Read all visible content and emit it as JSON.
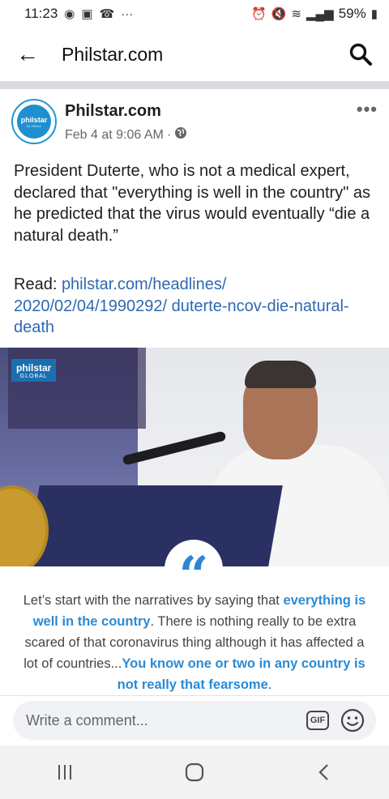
{
  "status_bar": {
    "time": "11:23",
    "battery": "59%",
    "overflow": "···"
  },
  "header": {
    "title": "Philstar.com"
  },
  "post": {
    "page_name": "Philstar.com",
    "timestamp": "Feb 4 at 9:06 AM",
    "separator": "·",
    "body": "President Duterte, who is not a medical expert, declared that \"everything is well in the country\" as he predicted that the virus would eventually “die a natural death.”",
    "read_label": "Read: ",
    "link": "philstar.com/headlines/ 2020/02/04/1990292/ duterte-ncov-die-natural-death",
    "more": "•••",
    "avatar_text": "philstar",
    "avatar_sub": "GLOBAL"
  },
  "photo": {
    "logo_text": "philstar",
    "logo_sub": "GLOBAL",
    "quote_glyph": "“",
    "quote": {
      "part1": "Let’s start with the narratives by saying that ",
      "highlight1": "everything is well in the country",
      "part2": ". There is nothing really to be extra scared of that coronavirus thing although it has affected a lot of countries...",
      "highlight2": "You know one or two in any country is not really that fearsome"
    }
  },
  "comment": {
    "placeholder": "Write a comment...",
    "gif_label": "GIF"
  },
  "colors": {
    "link": "#2d69b1",
    "quote_accent": "#2b86d6",
    "brand": "#1e8fd0"
  }
}
